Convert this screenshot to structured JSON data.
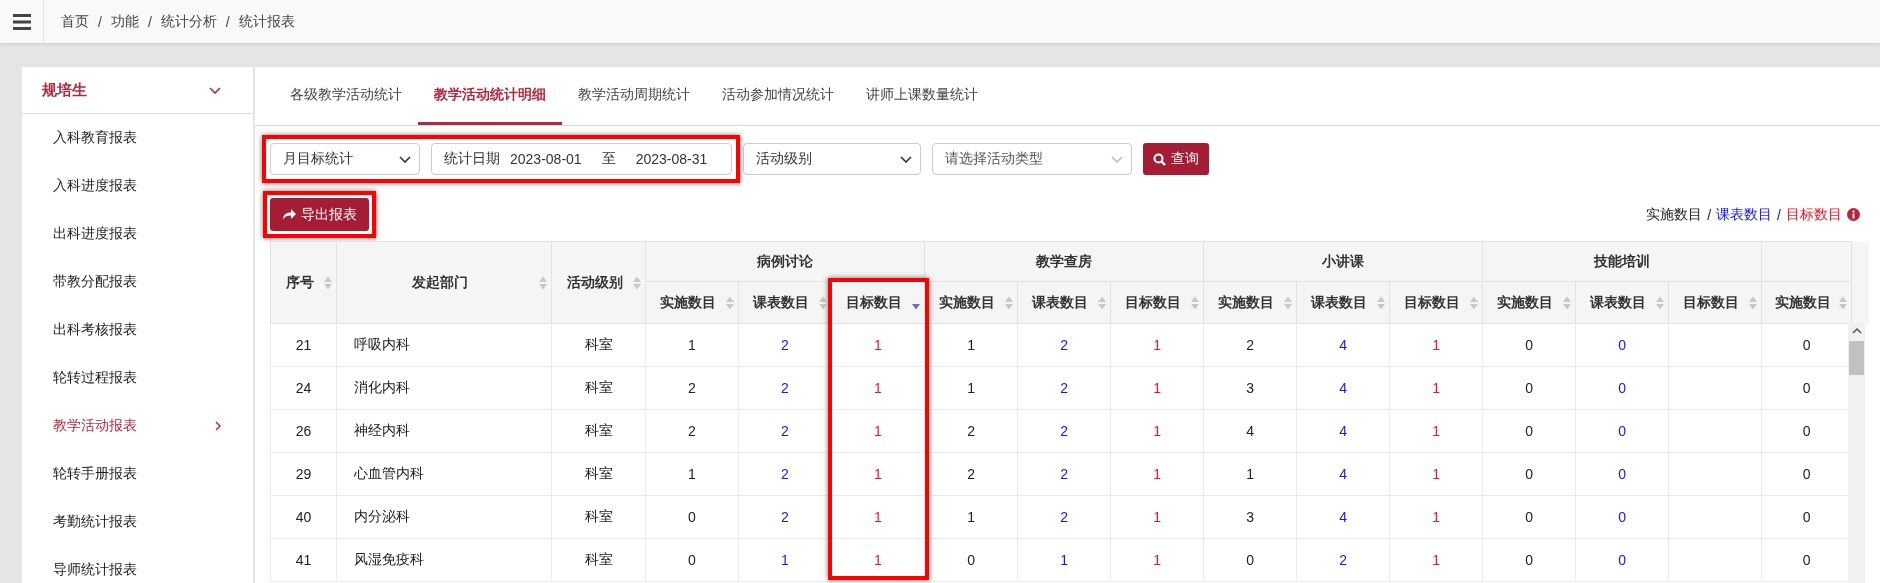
{
  "topbar": {
    "breadcrumb": [
      "首页",
      "功能",
      "统计分析",
      "统计报表"
    ],
    "separator": "/"
  },
  "sidebar": {
    "group": {
      "label": "规培生",
      "expanded": true
    },
    "items": [
      {
        "label": "入科教育报表",
        "selected": false
      },
      {
        "label": "入科进度报表",
        "selected": false
      },
      {
        "label": "出科进度报表",
        "selected": false
      },
      {
        "label": "带教分配报表",
        "selected": false
      },
      {
        "label": "出科考核报表",
        "selected": false
      },
      {
        "label": "轮转过程报表",
        "selected": false
      },
      {
        "label": "教学活动报表",
        "selected": true
      },
      {
        "label": "轮转手册报表",
        "selected": false
      },
      {
        "label": "考勤统计报表",
        "selected": false
      },
      {
        "label": "导师统计报表",
        "selected": false
      }
    ]
  },
  "tabs": [
    {
      "label": "各级教学活动统计",
      "selected": false
    },
    {
      "label": "教学活动统计明细",
      "selected": true
    },
    {
      "label": "教学活动周期统计",
      "selected": false
    },
    {
      "label": "活动参加情况统计",
      "selected": false
    },
    {
      "label": "讲师上课数量统计",
      "selected": false
    }
  ],
  "filters": {
    "highlighted": true,
    "period": {
      "value": "月目标统计"
    },
    "date_range": {
      "label": "统计日期",
      "start": "2023-08-01",
      "separator": "至",
      "end": "2023-08-31"
    },
    "level": {
      "value": "活动级别"
    },
    "type": {
      "placeholder": "请选择活动类型"
    },
    "query_button": "查询"
  },
  "export_button": {
    "label": "导出报表",
    "highlighted": true
  },
  "legend": {
    "separator": "/",
    "items": [
      {
        "label": "实施数目",
        "kind": "actual"
      },
      {
        "label": "课表数目",
        "kind": "schedule"
      },
      {
        "label": "目标数目",
        "kind": "target"
      }
    ]
  },
  "table": {
    "fixed_columns": [
      {
        "label": "序号",
        "sorted_desc": false
      },
      {
        "label": "发起部门",
        "sorted_desc": false
      },
      {
        "label": "活动级别",
        "sorted_desc": false
      }
    ],
    "groups": [
      {
        "title": "病例讨论",
        "columns": [
          {
            "label": "实施数目",
            "kind": "actual",
            "sorted_desc": false,
            "highlighted": false
          },
          {
            "label": "课表数目",
            "kind": "schedule",
            "sorted_desc": false,
            "highlighted": false
          },
          {
            "label": "目标数目",
            "kind": "target",
            "sorted_desc": true,
            "highlighted": true
          }
        ]
      },
      {
        "title": "教学查房",
        "columns": [
          {
            "label": "实施数目",
            "kind": "actual",
            "sorted_desc": false,
            "highlighted": false
          },
          {
            "label": "课表数目",
            "kind": "schedule",
            "sorted_desc": false,
            "highlighted": false
          },
          {
            "label": "目标数目",
            "kind": "target",
            "sorted_desc": false,
            "highlighted": false
          }
        ]
      },
      {
        "title": "小讲课",
        "columns": [
          {
            "label": "实施数目",
            "kind": "actual",
            "sorted_desc": false,
            "highlighted": false
          },
          {
            "label": "课表数目",
            "kind": "schedule",
            "sorted_desc": false,
            "highlighted": false
          },
          {
            "label": "目标数目",
            "kind": "target",
            "sorted_desc": false,
            "highlighted": false
          }
        ]
      },
      {
        "title": "技能培训",
        "columns": [
          {
            "label": "实施数目",
            "kind": "actual",
            "sorted_desc": false,
            "highlighted": false
          },
          {
            "label": "课表数目",
            "kind": "schedule",
            "sorted_desc": false,
            "highlighted": false
          },
          {
            "label": "目标数目",
            "kind": "target",
            "sorted_desc": false,
            "highlighted": false
          }
        ]
      },
      {
        "columns": [
          {
            "label": "实施数目",
            "kind": "actual",
            "sorted_desc": false,
            "highlighted": false
          }
        ]
      }
    ],
    "rows": [
      {
        "cells": [
          "21",
          "呼吸内科",
          "科室"
        ],
        "groups": [
          [
            "1",
            "2",
            "1"
          ],
          [
            "1",
            "2",
            "1"
          ],
          [
            "2",
            "4",
            "1"
          ],
          [
            "0",
            "0"
          ],
          [
            "0"
          ]
        ]
      },
      {
        "cells": [
          "24",
          "消化内科",
          "科室"
        ],
        "groups": [
          [
            "2",
            "2",
            "1"
          ],
          [
            "1",
            "2",
            "1"
          ],
          [
            "3",
            "4",
            "1"
          ],
          [
            "0",
            "0"
          ],
          [
            "0"
          ]
        ]
      },
      {
        "cells": [
          "26",
          "神经内科",
          "科室"
        ],
        "groups": [
          [
            "2",
            "2",
            "1"
          ],
          [
            "2",
            "2",
            "1"
          ],
          [
            "4",
            "4",
            "1"
          ],
          [
            "0",
            "0"
          ],
          [
            "0"
          ]
        ]
      },
      {
        "cells": [
          "29",
          "心血管内科",
          "科室"
        ],
        "groups": [
          [
            "1",
            "2",
            "1"
          ],
          [
            "2",
            "2",
            "1"
          ],
          [
            "1",
            "4",
            "1"
          ],
          [
            "0",
            "0"
          ],
          [
            "0"
          ]
        ]
      },
      {
        "cells": [
          "40",
          "内分泌科",
          "科室"
        ],
        "groups": [
          [
            "0",
            "2",
            "1"
          ],
          [
            "1",
            "2",
            "1"
          ],
          [
            "3",
            "4",
            "1"
          ],
          [
            "0",
            "0"
          ],
          [
            "0"
          ]
        ]
      },
      {
        "cells": [
          "41",
          "风湿免疫科",
          "科室"
        ],
        "groups": [
          [
            "0",
            "1",
            "1"
          ],
          [
            "0",
            "1",
            "1"
          ],
          [
            "0",
            "2",
            "1"
          ],
          [
            "0",
            "0"
          ],
          [
            "0"
          ]
        ]
      }
    ]
  }
}
